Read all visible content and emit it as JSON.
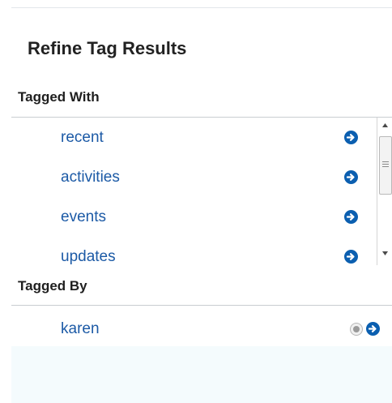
{
  "panel": {
    "title": "Refine Tag Results"
  },
  "tagged_with": {
    "header": "Tagged With",
    "items": [
      {
        "label": "recent",
        "action_icon": "arrow-right-circle-icon"
      },
      {
        "label": "activities",
        "action_icon": "arrow-right-circle-icon"
      },
      {
        "label": "events",
        "action_icon": "arrow-right-circle-icon"
      },
      {
        "label": "updates",
        "action_icon": "arrow-right-circle-icon"
      }
    ]
  },
  "tagged_by": {
    "header": "Tagged By",
    "items": [
      {
        "label": "karen",
        "select_icon": "radio-icon",
        "action_icon": "arrow-right-circle-icon"
      }
    ]
  },
  "colors": {
    "link": "#1c5aa6",
    "action_button": "#0b5fb0",
    "tagged_by_background": "#f4fbfd"
  }
}
